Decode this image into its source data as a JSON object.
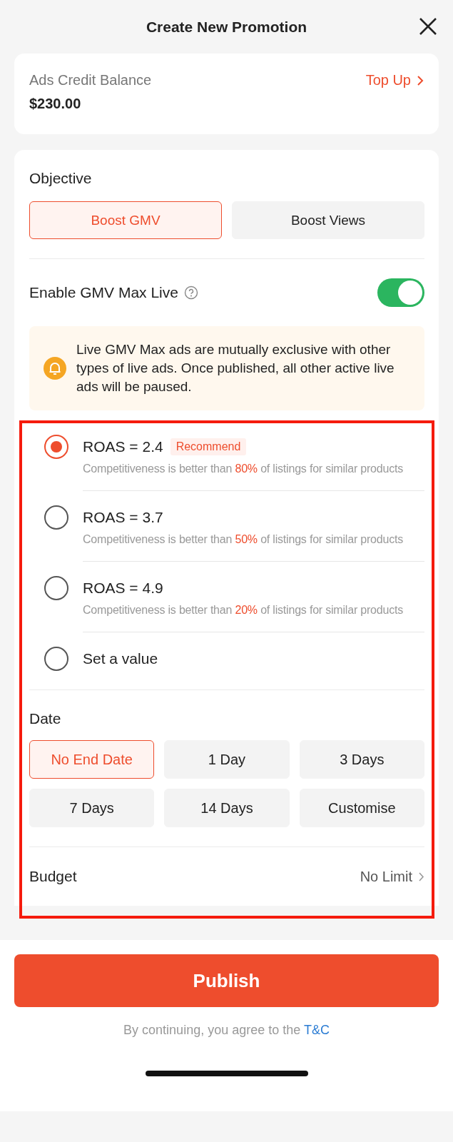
{
  "header": {
    "title": "Create New Promotion"
  },
  "balance": {
    "label": "Ads Credit Balance",
    "amount": "$230.00",
    "action": "Top Up"
  },
  "objective": {
    "label": "Objective",
    "options": [
      {
        "label": "Boost GMV",
        "selected": true
      },
      {
        "label": "Boost Views",
        "selected": false
      }
    ]
  },
  "gmv_max": {
    "label": "Enable GMV Max Live",
    "on": true
  },
  "notice": {
    "text": "Live GMV Max ads are mutually exclusive with other types of live ads. Once published, all other active live ads will be paused."
  },
  "roas_options": [
    {
      "label": "ROAS = 2.4",
      "badge": "Recommend",
      "selected": true,
      "text_before": "Competitiveness is better than ",
      "percent": "80%",
      "text_after": " of listings for similar products"
    },
    {
      "label": "ROAS = 3.7",
      "selected": false,
      "text_before": "Competitiveness is better than ",
      "percent": "50%",
      "text_after": " of listings for similar products"
    },
    {
      "label": "ROAS = 4.9",
      "selected": false,
      "text_before": "Competitiveness is better than ",
      "percent": "20%",
      "text_after": " of listings for similar products"
    },
    {
      "label": "Set a value",
      "selected": false
    }
  ],
  "date": {
    "label": "Date",
    "options": [
      {
        "label": "No End Date",
        "selected": true
      },
      {
        "label": "1 Day",
        "selected": false
      },
      {
        "label": "3 Days",
        "selected": false
      },
      {
        "label": "7 Days",
        "selected": false
      },
      {
        "label": "14 Days",
        "selected": false
      },
      {
        "label": "Customise",
        "selected": false
      }
    ]
  },
  "budget": {
    "label": "Budget",
    "value": "No Limit"
  },
  "publish": {
    "label": "Publish"
  },
  "terms": {
    "text": "By continuing, you agree to the ",
    "link": "T&C"
  }
}
